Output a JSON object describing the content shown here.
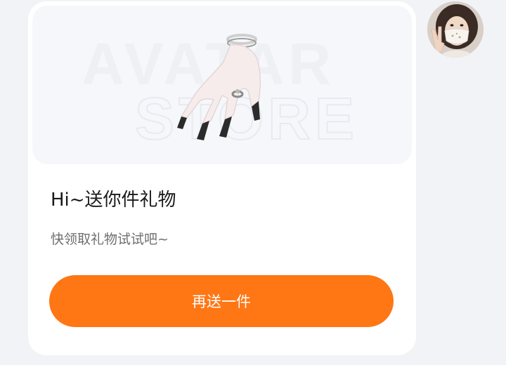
{
  "banner": {
    "watermark_line1": "AVATAR",
    "watermark_line2": "STORE",
    "item_icon": "hand-with-ring-and-bracelet-icon"
  },
  "gift": {
    "title": "Hi~送你件礼物",
    "subtitle": "快领取礼物试试吧~",
    "button_label": "再送一件"
  },
  "colors": {
    "page_background": "#f1f3f6",
    "card_background": "#ffffff",
    "banner_background": "#f5f7fa",
    "accent_orange": "#ff7614",
    "title_text": "#1a1a1a",
    "subtitle_text": "#6f6f6f"
  },
  "user": {
    "avatar_icon": "user-avatar-photo"
  }
}
